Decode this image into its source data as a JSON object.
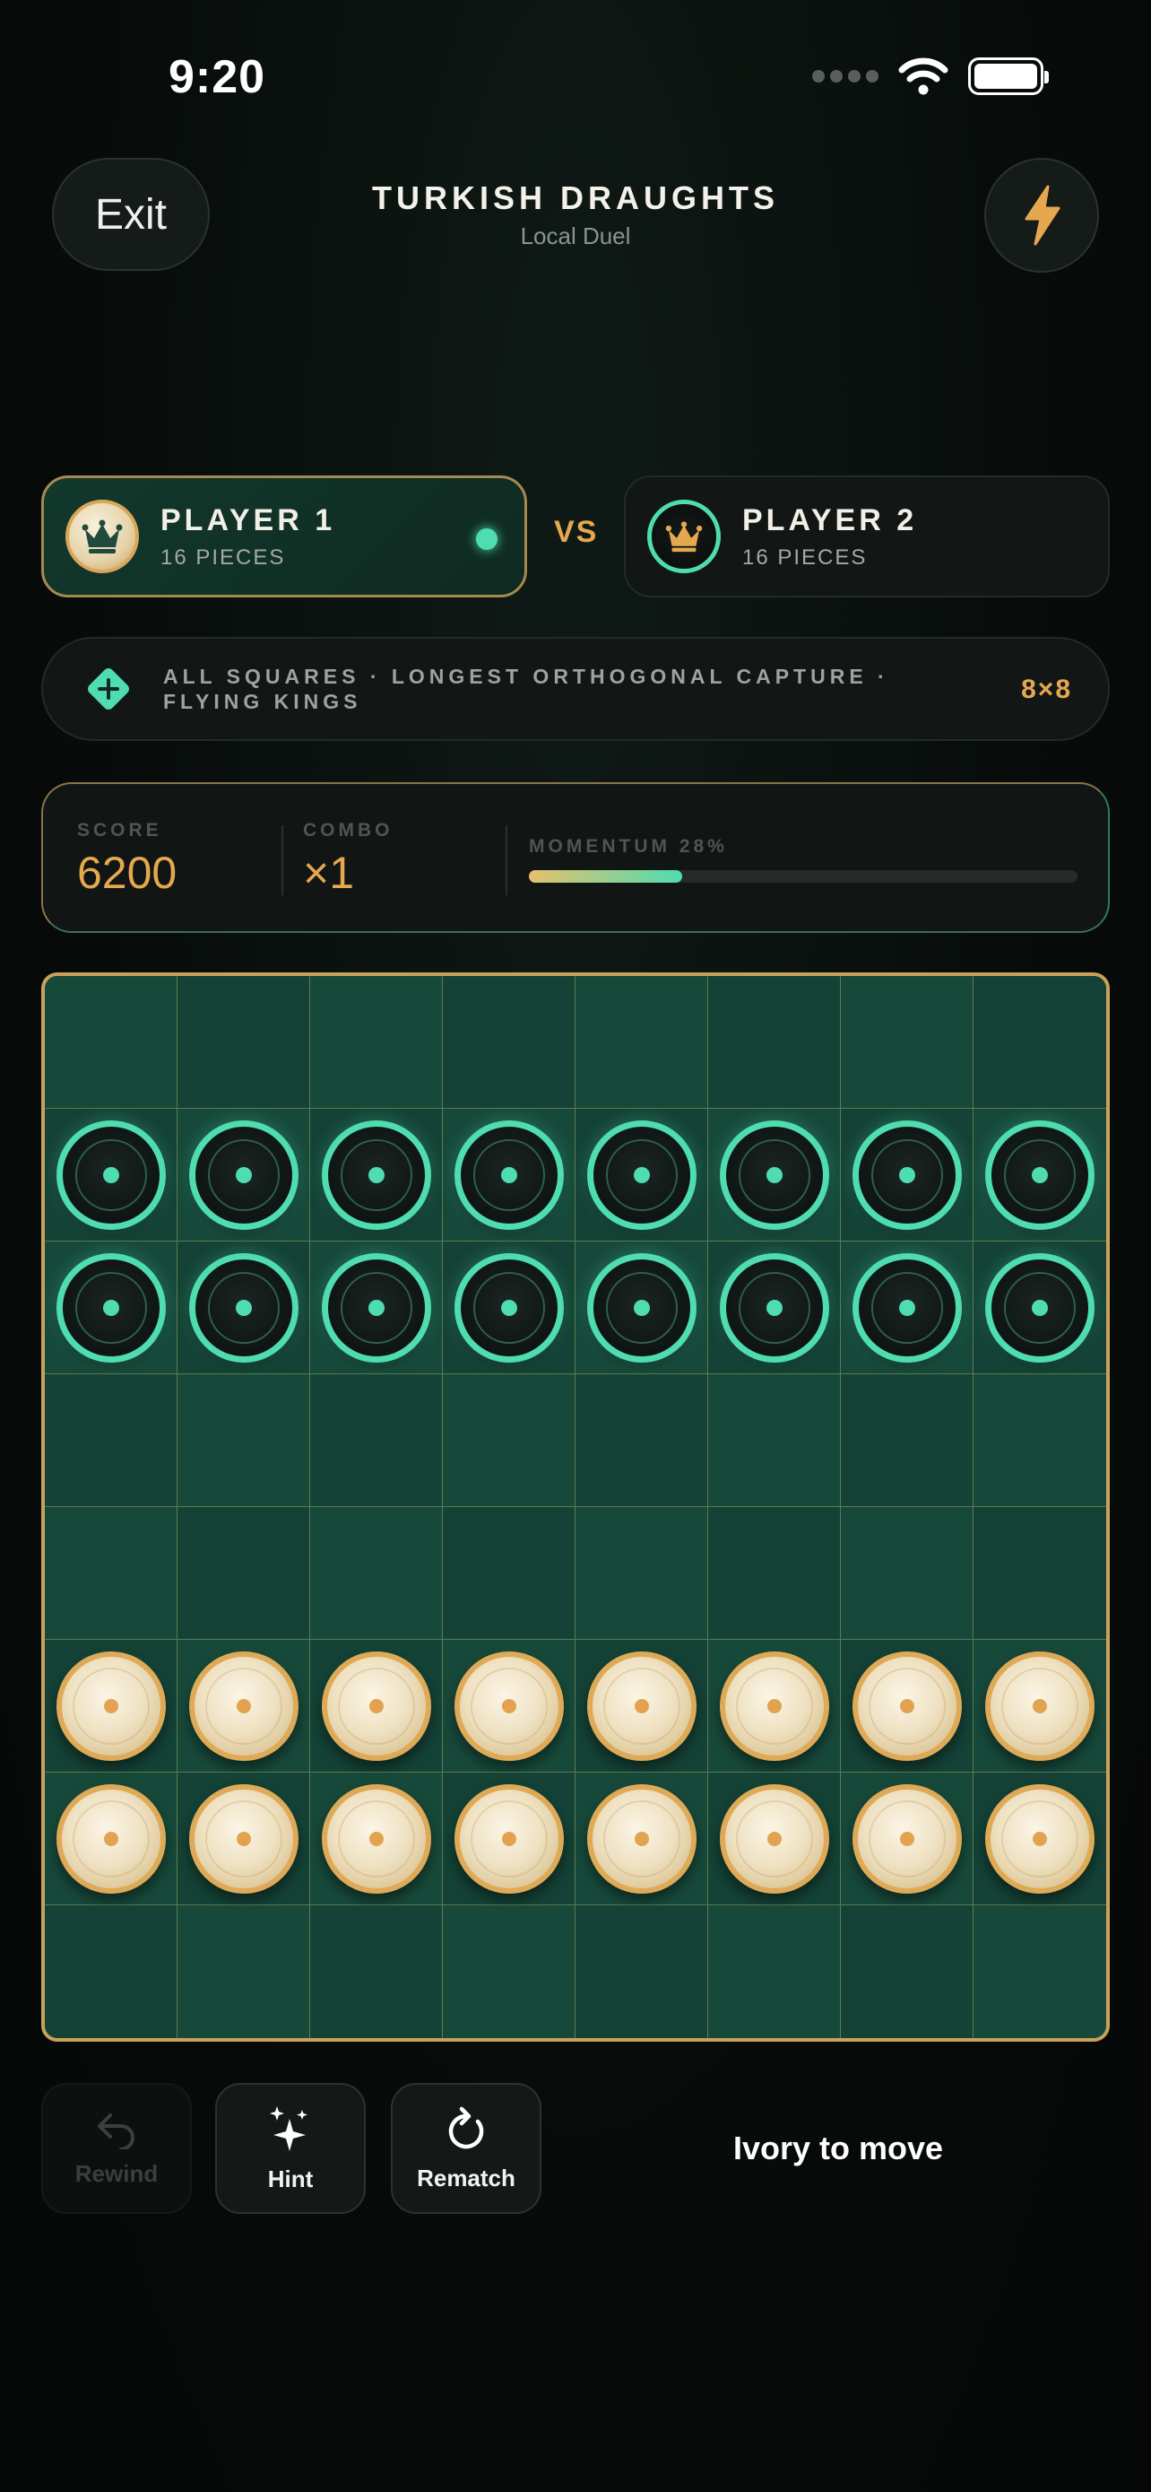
{
  "status_bar": {
    "time": "9:20"
  },
  "header": {
    "exit_label": "Exit",
    "title": "TURKISH DRAUGHTS",
    "subtitle": "Local Duel",
    "bolt_icon": "lightning-bolt-icon"
  },
  "players": [
    {
      "name": "PLAYER 1",
      "pieces": "16 PIECES",
      "color": "ivory",
      "active": true
    },
    {
      "name": "PLAYER 2",
      "pieces": "16 PIECES",
      "color": "dark",
      "active": false
    }
  ],
  "vs_label": "VS",
  "rules": {
    "text": "ALL SQUARES · LONGEST ORTHOGONAL CAPTURE · FLYING KINGS",
    "board_size": "8×8"
  },
  "stats": {
    "score_label": "SCORE",
    "score_value": "6200",
    "combo_label": "COMBO",
    "combo_value": "×1",
    "momentum_label": "MOMENTUM 28%",
    "momentum": 0.28
  },
  "board": {
    "rows": [
      [
        "",
        "",
        "",
        "",
        "",
        "",
        "",
        ""
      ],
      [
        "D",
        "D",
        "D",
        "D",
        "D",
        "D",
        "D",
        "D"
      ],
      [
        "D",
        "D",
        "D",
        "D",
        "D",
        "D",
        "D",
        "D"
      ],
      [
        "",
        "",
        "",
        "",
        "",
        "",
        "",
        ""
      ],
      [
        "",
        "",
        "",
        "",
        "",
        "",
        "",
        ""
      ],
      [
        "I",
        "I",
        "I",
        "I",
        "I",
        "I",
        "I",
        "I"
      ],
      [
        "I",
        "I",
        "I",
        "I",
        "I",
        "I",
        "I",
        "I"
      ],
      [
        "",
        "",
        "",
        "",
        "",
        "",
        "",
        ""
      ]
    ]
  },
  "controls": {
    "rewind_label": "Rewind",
    "hint_label": "Hint",
    "rematch_label": "Rematch"
  },
  "turn_text": "Ivory to move",
  "colors": {
    "accent_gold": "#e6a84e",
    "accent_teal": "#4fdcb0",
    "board_green": "#17493a"
  }
}
